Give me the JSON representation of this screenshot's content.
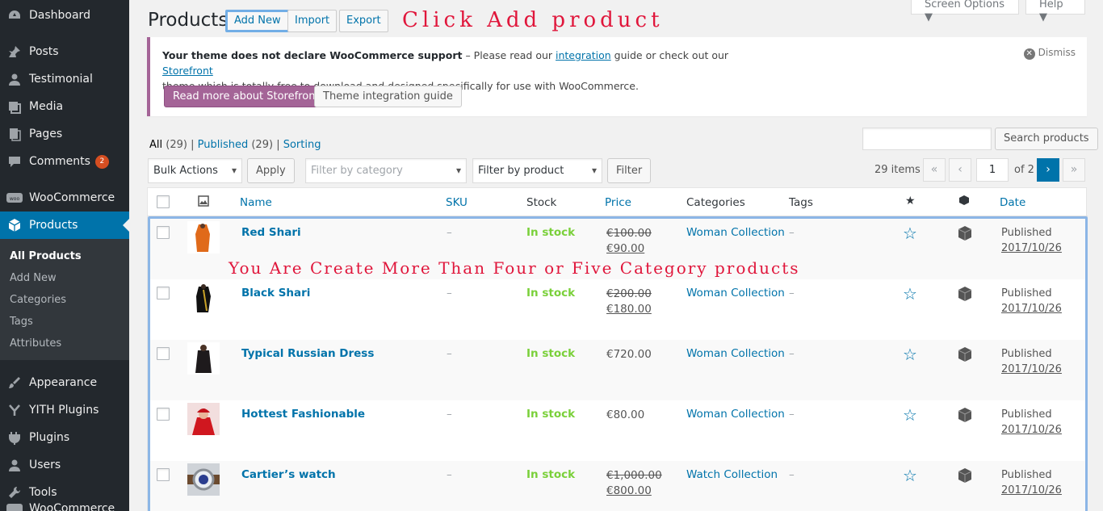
{
  "sidebar": {
    "items": [
      {
        "label": "Dashboard",
        "icon": "dashboard-icon"
      },
      {
        "label": "Posts",
        "icon": "pin-icon"
      },
      {
        "label": "Testimonial",
        "icon": "user-icon"
      },
      {
        "label": "Media",
        "icon": "media-icon"
      },
      {
        "label": "Pages",
        "icon": "pages-icon"
      },
      {
        "label": "Comments",
        "icon": "comments-icon",
        "badge": "2"
      },
      {
        "label": "WooCommerce",
        "icon": "woocommerce-icon"
      },
      {
        "label": "Products",
        "icon": "products-icon"
      },
      {
        "label": "Appearance",
        "icon": "appearance-icon"
      },
      {
        "label": "YITH Plugins",
        "icon": "yith-icon"
      },
      {
        "label": "Plugins",
        "icon": "plugins-icon"
      },
      {
        "label": "Users",
        "icon": "users-icon"
      },
      {
        "label": "Tools",
        "icon": "tools-icon"
      },
      {
        "label": "WooCommerce",
        "icon": "woocommerce-icon"
      }
    ],
    "submenu": [
      "All Products",
      "Add New",
      "Categories",
      "Tags",
      "Attributes"
    ]
  },
  "header": {
    "title": "Products",
    "add_new": "Add New",
    "import": "Import",
    "export": "Export",
    "screen_options": "Screen Options ▼",
    "help": "Help ▼"
  },
  "annotations": {
    "click_add": "Click Add product",
    "create_more": "You Are Create More Than Four or Five Category products"
  },
  "notice": {
    "bold": "Your theme does not declare WooCommerce support",
    "text1": " – Please read our ",
    "link1": "integration",
    "text2": " guide or check out our ",
    "link2": "Storefront",
    "text3": "theme which is totally free to download and designed specifically for use with WooCommerce.",
    "btn_primary": "Read more about Storefront",
    "btn_secondary": "Theme integration guide",
    "dismiss": "Dismiss"
  },
  "views": {
    "all": "All",
    "all_count": "(29)",
    "published": "Published",
    "published_count": "(29)",
    "sorting": "Sorting",
    "sep": "|"
  },
  "search": {
    "button": "Search products",
    "value": ""
  },
  "filters": {
    "bulk_actions": "Bulk Actions",
    "apply": "Apply",
    "category_placeholder": "Filter by category",
    "product_type": "Filter by product type",
    "filter": "Filter"
  },
  "pagination": {
    "items": "29 items",
    "first": "«",
    "prev": "‹",
    "current": "1",
    "of": "of 2",
    "next": "›",
    "last": "»"
  },
  "table": {
    "columns": {
      "name": "Name",
      "sku": "SKU",
      "stock": "Stock",
      "price": "Price",
      "categories": "Categories",
      "tags": "Tags",
      "date": "Date"
    },
    "rows": [
      {
        "name": "Red Shari",
        "sku": "–",
        "stock": "In stock",
        "price_old": "€100.00",
        "price_new": "€90.00",
        "category": "Woman Collection",
        "tags": "–",
        "status": "Published",
        "date": "2017/10/26"
      },
      {
        "name": "Black Shari",
        "sku": "–",
        "stock": "In stock",
        "price_old": "€200.00",
        "price_new": "€180.00",
        "category": "Woman Collection",
        "tags": "–",
        "status": "Published",
        "date": "2017/10/26"
      },
      {
        "name": "Typical Russian Dress",
        "sku": "–",
        "stock": "In stock",
        "price_old": "",
        "price_new": "€720.00",
        "category": "Woman Collection",
        "tags": "–",
        "status": "Published",
        "date": "2017/10/26"
      },
      {
        "name": "Hottest Fashionable",
        "sku": "–",
        "stock": "In stock",
        "price_old": "",
        "price_new": "€80.00",
        "category": "Woman Collection",
        "tags": "–",
        "status": "Published",
        "date": "2017/10/26"
      },
      {
        "name": "Cartier’s watch",
        "sku": "–",
        "stock": "In stock",
        "price_old": "€1,000.00",
        "price_new": "€800.00",
        "category": "Watch Collection",
        "tags": "–",
        "status": "Published",
        "date": "2017/10/26"
      }
    ]
  },
  "colors": {
    "sidebar_bg": "#23282d",
    "accent": "#0073aa",
    "woo_purple": "#a46497",
    "in_stock": "#7ad03a",
    "annotation_red": "#e0163b"
  }
}
